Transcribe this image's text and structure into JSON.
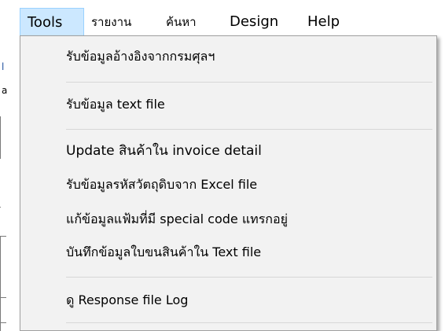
{
  "menubar": {
    "items": [
      {
        "label": "Tools",
        "active": true
      },
      {
        "label": "รายงาน"
      },
      {
        "label": "ค้นหา"
      },
      {
        "label": "Design"
      },
      {
        "label": "Help"
      }
    ]
  },
  "background": {
    "left_fragment_1": "l",
    "left_fragment_2": "a"
  },
  "tools_menu": {
    "items": [
      {
        "label": "รับข้อมูลอ้างอิงจากกรมศุลฯ"
      },
      {
        "label": "รับข้อมูล text file"
      },
      {
        "label": "Update สินค้าใน invoice detail"
      },
      {
        "label": "รับข้อมูลรหัสวัตถุดิบจาก Excel file"
      },
      {
        "label": "แก้ข้อมูลแฟ้มที่มี special code แทรกอยู่"
      },
      {
        "label": "บันทึกข้อมูลใบขนสินค้าใน Text file"
      },
      {
        "label": "ดู Response file Log"
      }
    ]
  },
  "colors": {
    "menu_background": "#f2f2f2",
    "active_menubar_item": "#cce8ff",
    "active_menubar_border": "#99d1ff"
  }
}
